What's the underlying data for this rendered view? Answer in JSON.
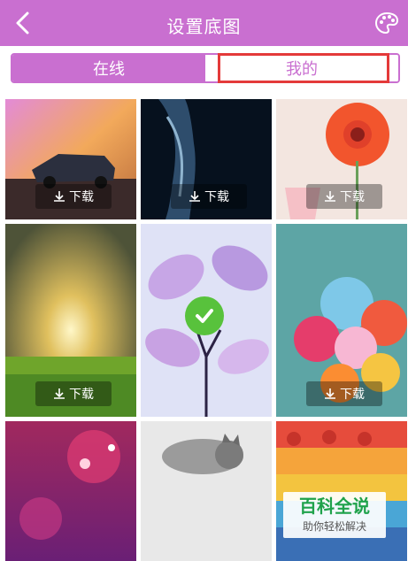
{
  "header": {
    "title": "设置底图",
    "back_icon": "chevron-left-icon",
    "palette_icon": "palette-icon"
  },
  "tabs": {
    "online_label": "在线",
    "mine_label": "我的"
  },
  "wallpapers": [
    {
      "id": 1,
      "download_label": "下载"
    },
    {
      "id": 2,
      "download_label": "下载"
    },
    {
      "id": 3,
      "download_label": "下载"
    },
    {
      "id": 4,
      "download_label": "下载"
    },
    {
      "id": 5,
      "selected": true
    },
    {
      "id": 6,
      "download_label": "下载"
    },
    {
      "id": 7
    },
    {
      "id": 8
    },
    {
      "id": 9
    }
  ],
  "watermark": {
    "title": "百科全说",
    "subtitle": "助你轻松解决"
  },
  "colors": {
    "accent": "#c96fd0",
    "highlight": "#e43a3a",
    "check": "#58c23c",
    "watermark_green": "#1fa24b"
  }
}
